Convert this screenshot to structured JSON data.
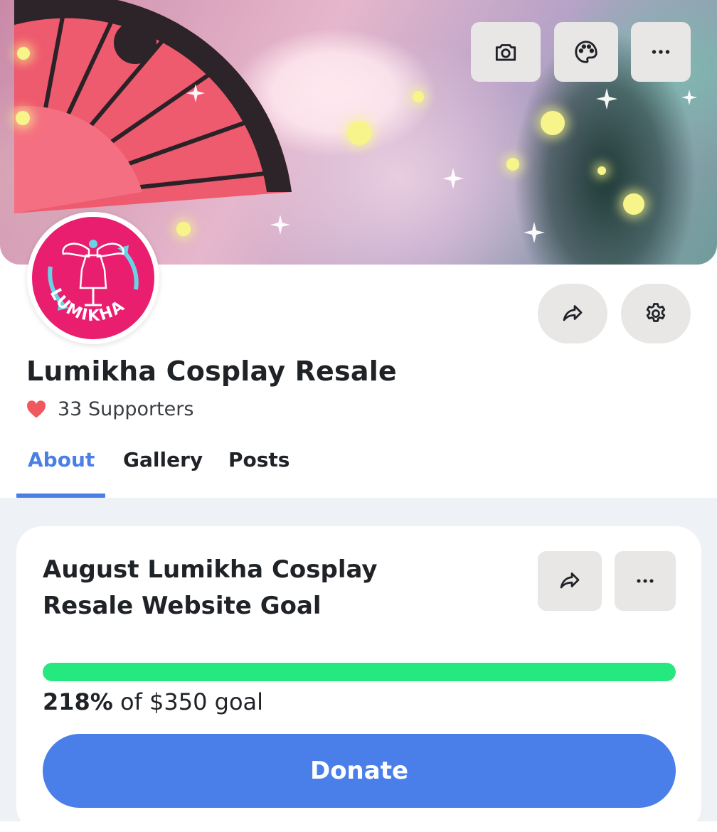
{
  "cover": {
    "buttons": [
      {
        "icon": "camera-icon"
      },
      {
        "icon": "palette-icon"
      },
      {
        "icon": "more-icon"
      }
    ]
  },
  "avatar": {
    "logo_text": "LUMIKHA",
    "color": "#e91e6f"
  },
  "profile": {
    "name": "Lumikha Cosplay Resale",
    "supporters": "33 Supporters",
    "share_icon": "share-icon",
    "settings_icon": "gear-icon"
  },
  "tabs": [
    {
      "label": "About",
      "active": true
    },
    {
      "label": "Gallery",
      "active": false
    },
    {
      "label": "Posts",
      "active": false
    }
  ],
  "goal": {
    "title": "August Lumikha Cosplay Resale Website Goal",
    "percent_text": "218%",
    "suffix_text": "of $350 goal",
    "progress_fraction": 1.0,
    "donate_label": "Donate"
  },
  "colors": {
    "accent": "#4a7fe6",
    "progress": "#25e87e",
    "heart": "#f0575e"
  }
}
